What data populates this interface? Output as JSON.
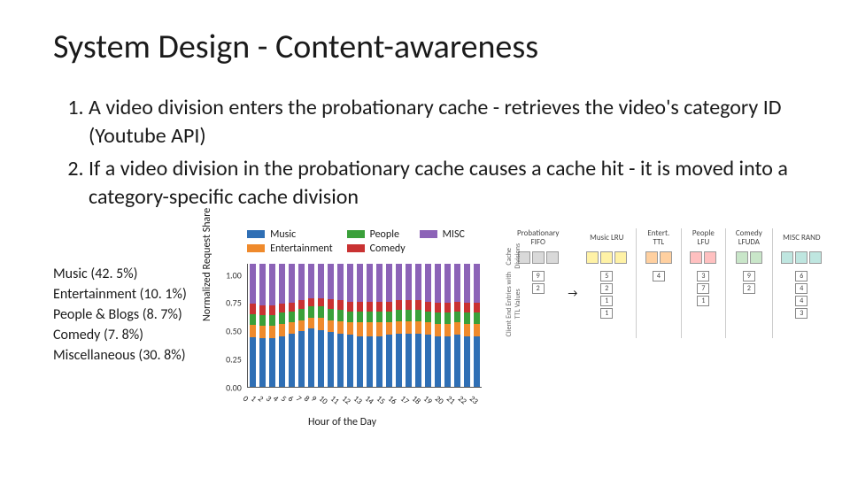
{
  "title": "System Design - Content-awareness",
  "bullets": [
    "A video division enters the probationary cache - retrieves the video's category ID (Youtube API)",
    "If a video division in the probationary cache causes a cache hit - it is moved into a category-specific cache division"
  ],
  "category_stats": [
    {
      "label": "Music",
      "pct": "42. 5%"
    },
    {
      "label": "Entertainment",
      "pct": "10. 1%"
    },
    {
      "label": "People & Blogs",
      "pct": "8. 7%"
    },
    {
      "label": "Comedy",
      "pct": "7. 8%"
    },
    {
      "label": "Miscellaneous",
      "pct": "30. 8%"
    }
  ],
  "chart_data": {
    "type": "bar",
    "title": "",
    "xlabel": "Hour of the Day",
    "ylabel": "Normalized Request Share",
    "ylim": [
      0,
      1.0
    ],
    "yticks": [
      "1.00",
      "0.75",
      "0.50",
      "0.25",
      "0.00"
    ],
    "categories": [
      "0",
      "1",
      "2",
      "3",
      "4",
      "5",
      "6",
      "7",
      "8",
      "9",
      "10",
      "11",
      "12",
      "13",
      "14",
      "15",
      "16",
      "17",
      "18",
      "19",
      "20",
      "21",
      "22",
      "23"
    ],
    "series": [
      {
        "name": "Music",
        "color": "#2f6fb5",
        "values": [
          0.4,
          0.39,
          0.39,
          0.41,
          0.43,
          0.45,
          0.47,
          0.46,
          0.44,
          0.43,
          0.42,
          0.41,
          0.41,
          0.41,
          0.42,
          0.43,
          0.43,
          0.43,
          0.42,
          0.41,
          0.41,
          0.42,
          0.41,
          0.41
        ]
      },
      {
        "name": "Entertainment",
        "color": "#ef8a2c",
        "values": [
          0.1,
          0.1,
          0.1,
          0.1,
          0.09,
          0.09,
          0.09,
          0.1,
          0.1,
          0.1,
          0.1,
          0.11,
          0.11,
          0.11,
          0.1,
          0.1,
          0.1,
          0.1,
          0.1,
          0.1,
          0.1,
          0.1,
          0.1,
          0.1
        ]
      },
      {
        "name": "People",
        "color": "#3aa03a",
        "values": [
          0.09,
          0.09,
          0.09,
          0.09,
          0.09,
          0.09,
          0.09,
          0.09,
          0.09,
          0.09,
          0.09,
          0.09,
          0.09,
          0.09,
          0.09,
          0.09,
          0.09,
          0.09,
          0.09,
          0.09,
          0.09,
          0.09,
          0.09,
          0.09
        ]
      },
      {
        "name": "Comedy",
        "color": "#c93232",
        "values": [
          0.08,
          0.08,
          0.08,
          0.07,
          0.07,
          0.07,
          0.07,
          0.07,
          0.08,
          0.08,
          0.08,
          0.08,
          0.08,
          0.08,
          0.08,
          0.08,
          0.08,
          0.08,
          0.08,
          0.08,
          0.08,
          0.08,
          0.08,
          0.08
        ]
      },
      {
        "name": "MISC",
        "color": "#8c63b7",
        "values": [
          0.33,
          0.34,
          0.34,
          0.33,
          0.32,
          0.3,
          0.28,
          0.28,
          0.29,
          0.3,
          0.31,
          0.31,
          0.31,
          0.31,
          0.31,
          0.3,
          0.3,
          0.3,
          0.31,
          0.32,
          0.32,
          0.31,
          0.32,
          0.32
        ]
      }
    ],
    "legend_layout": [
      [
        "Music",
        "People",
        "MISC"
      ],
      [
        "Entertainment",
        "Comedy",
        ""
      ]
    ]
  },
  "diagram": {
    "side_labels": {
      "top": "Cache Divisions",
      "bottom": "Client End Entries with TTL Values"
    },
    "columns": [
      {
        "title": "Probationary\nFIFO",
        "color": "#d9d9d9",
        "cells": 3,
        "ttls": [
          "9",
          "2"
        ]
      },
      {
        "title": "Music\nLRU",
        "color": "#fff2a6",
        "cells": 3,
        "ttls": [
          "5",
          "2",
          "1",
          "1"
        ]
      },
      {
        "title": "Entert.\nTTL",
        "color": "#ffd0a0",
        "cells": 2,
        "ttls": [
          "4"
        ]
      },
      {
        "title": "People\nLFU",
        "color": "#ffc0c0",
        "cells": 2,
        "ttls": [
          "3",
          "7",
          "1"
        ]
      },
      {
        "title": "Comedy\nLFUDA",
        "color": "#c9e6c9",
        "cells": 2,
        "ttls": [
          "9",
          "2"
        ]
      },
      {
        "title": "MISC\nRAND",
        "color": "#bfe6e0",
        "cells": 3,
        "ttls": [
          "6",
          "4",
          "4",
          "3"
        ]
      }
    ]
  }
}
